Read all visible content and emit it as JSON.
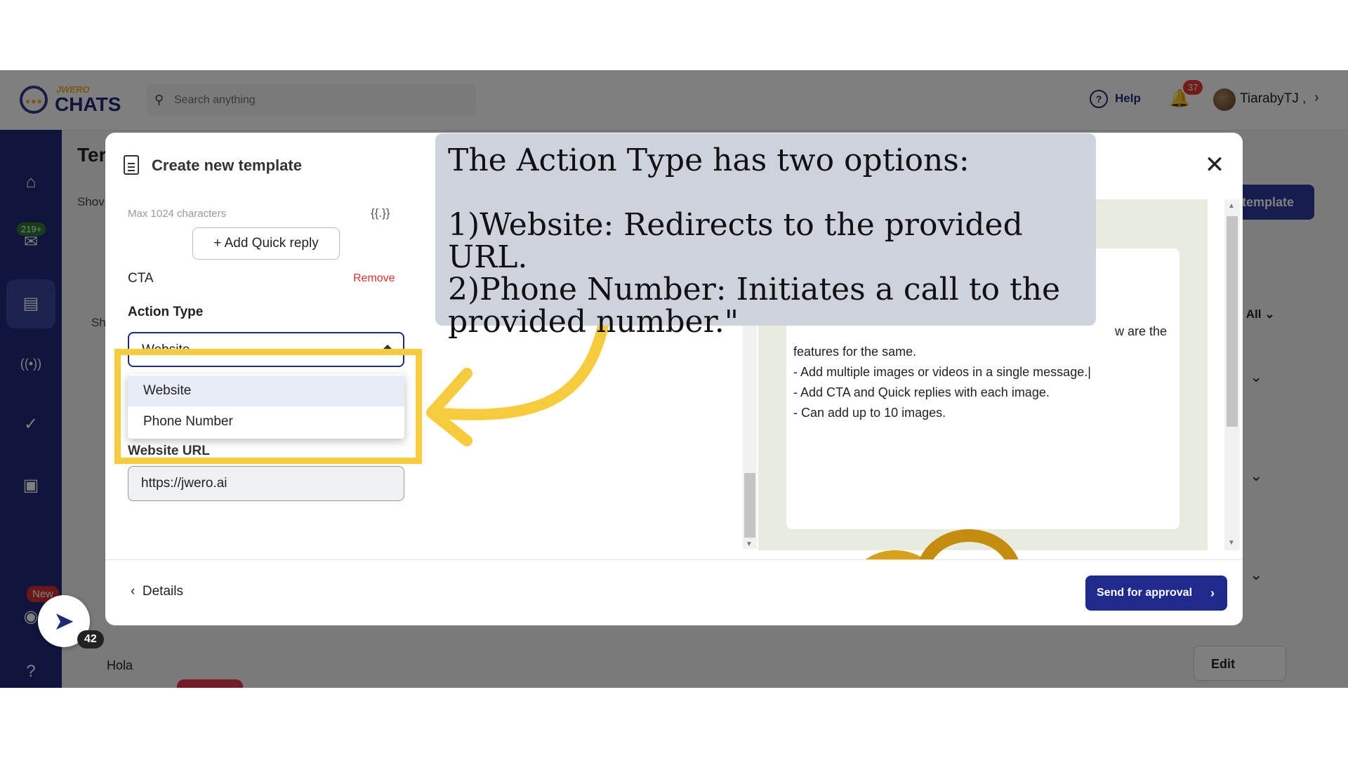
{
  "app": {
    "logo_small": "JWERO",
    "logo_big": "CHATS"
  },
  "search": {
    "placeholder": "Search anything"
  },
  "header": {
    "help_label": "Help",
    "notification_count": "37",
    "username": "TiarabyTJ ,"
  },
  "sidebar": {
    "badge": "219+",
    "new_badge": "New"
  },
  "page": {
    "title": "Ter",
    "show_label": "Shov",
    "sh_label": "Sh",
    "create_button": "template",
    "filter_label": ": All",
    "row_label": "Hola",
    "edit_button": "Edit"
  },
  "modal": {
    "title": "Create new template",
    "max_chars": "Max 1024 characters",
    "variable_button": "{{.}}",
    "add_quick_reply": "+ Add Quick reply",
    "cta_label": "CTA",
    "remove_label": "Remove",
    "action_type_label": "Action Type",
    "action_type_value": "Website",
    "options": [
      "Website",
      "Phone Number"
    ],
    "website_url_label": "Website URL",
    "website_url_value": "https://jwero.ai",
    "preview_lines": [
      "w are the",
      "features for the same.",
      "- Add multiple images or videos in a single message.|",
      "- Add CTA and Quick replies with each image.",
      "- Can add up to 10 images."
    ],
    "details_button": "Details",
    "send_button": "Send for approval"
  },
  "callout": {
    "text": "The Action Type has two options:\n\n1)Website: Redirects to the provided URL.\n2)Phone Number: Initiates a call to the provided number.\""
  },
  "rocket": {
    "count": "42"
  },
  "colors": {
    "brand": "#1f2a78",
    "highlight": "#f7cb3e",
    "danger": "#d32f2f"
  }
}
